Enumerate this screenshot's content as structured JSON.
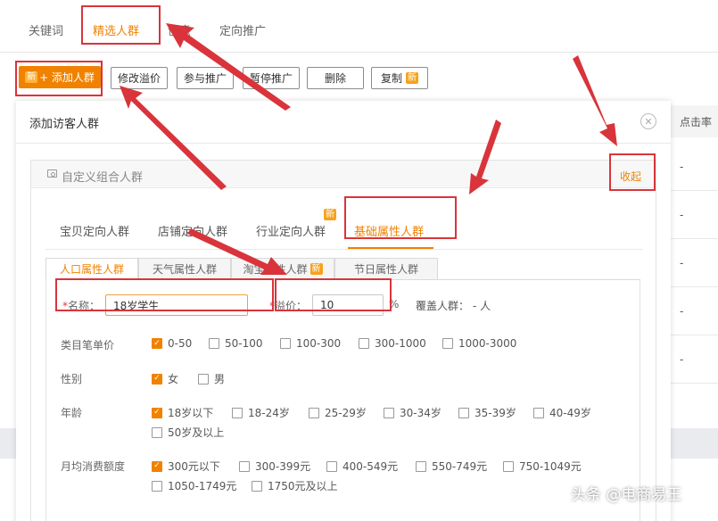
{
  "top_tabs": [
    {
      "label": "关键词"
    },
    {
      "label": "精选人群"
    },
    {
      "label": "创意"
    },
    {
      "label": "定向推广"
    }
  ],
  "toolbar": {
    "add_badge": "新",
    "add_label": "+ 添加人群",
    "modify_premium": "修改溢价",
    "join_promo": "参与推广",
    "pause_promo": "暂停推广",
    "delete": "删除",
    "copy": "复制",
    "copy_badge": "新"
  },
  "bg_table": {
    "header": "点击率",
    "cells": [
      "-",
      "-",
      "-",
      "-",
      "-"
    ]
  },
  "modal": {
    "title": "添加访客人群",
    "close_icon": "close-icon",
    "section_title": "自定义组合人群",
    "collapse": "收起",
    "sub_tabs": [
      {
        "label": "宝贝定向人群"
      },
      {
        "label": "店铺定向人群"
      },
      {
        "label": "行业定向人群"
      },
      {
        "label": "基础属性人群"
      }
    ],
    "sub_new_badge": "新",
    "inner_tabs": [
      {
        "label": "人口属性人群"
      },
      {
        "label": "天气属性人群"
      },
      {
        "label": "淘宝属性人群",
        "badge": "新"
      },
      {
        "label": "节日属性人群"
      }
    ],
    "form": {
      "required_mark": "*",
      "name_label": "名称：",
      "name_value": "18岁学生",
      "premium_label": "溢价：",
      "premium_value": "10",
      "percent": "%",
      "coverage_label": "覆盖人群：",
      "coverage_value": "- 人",
      "price_label": "类目笔单价",
      "price_options": [
        {
          "label": "0-50",
          "checked": true
        },
        {
          "label": "50-100",
          "checked": false
        },
        {
          "label": "100-300",
          "checked": false
        },
        {
          "label": "300-1000",
          "checked": false
        },
        {
          "label": "1000-3000",
          "checked": false
        }
      ],
      "gender_label": "性别",
      "gender_options": [
        {
          "label": "女",
          "checked": true
        },
        {
          "label": "男",
          "checked": false
        }
      ],
      "age_label": "年龄",
      "age_options": [
        {
          "label": "18岁以下",
          "checked": true
        },
        {
          "label": "18-24岁",
          "checked": false
        },
        {
          "label": "25-29岁",
          "checked": false
        },
        {
          "label": "30-34岁",
          "checked": false
        },
        {
          "label": "35-39岁",
          "checked": false
        },
        {
          "label": "40-49岁",
          "checked": false
        },
        {
          "label": "50岁及以上",
          "checked": false
        }
      ],
      "spend_label": "月均消费额度",
      "spend_options": [
        {
          "label": "300元以下",
          "checked": true
        },
        {
          "label": "300-399元",
          "checked": false
        },
        {
          "label": "400-549元",
          "checked": false
        },
        {
          "label": "550-749元",
          "checked": false
        },
        {
          "label": "750-1049元",
          "checked": false
        },
        {
          "label": "1050-1749元",
          "checked": false
        },
        {
          "label": "1750元及以上",
          "checked": false
        }
      ]
    }
  },
  "watermark": "头条 @电商易王",
  "colors": {
    "accent": "#f08200",
    "annotation": "#d9343b",
    "badge": "#f7a21b"
  }
}
